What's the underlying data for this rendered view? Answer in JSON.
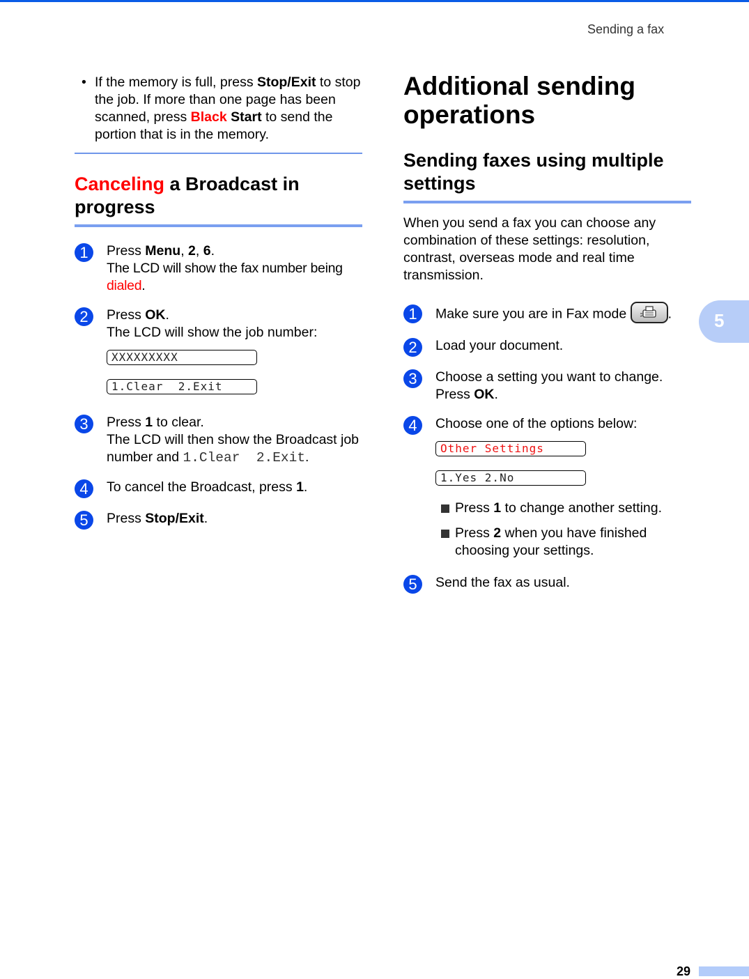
{
  "header": {
    "running_title": "Sending a fax"
  },
  "left": {
    "bullet": {
      "glyph": "•",
      "t1": "If the memory is full, press ",
      "b1": "Stop/Exit",
      "t2": " to stop the job. If more than one page has been scanned, press ",
      "r1": "Black",
      "t3": " ",
      "b2": "Start",
      "t4": " to send the portion that is in the memory."
    },
    "section_title_red": "Canceling",
    "section_title_rest": " a Broadcast in progress",
    "steps": [
      {
        "num": "1",
        "t1": "Press ",
        "b1": "Menu",
        "t2": ", ",
        "b2": "2",
        "t3": ", ",
        "b3": "6",
        "t4": ".",
        "line2": "The LCD will show the fax number being ",
        "red": "dialed",
        "end": "."
      },
      {
        "num": "2",
        "t1": "Press ",
        "b1": "OK",
        "t2": ".",
        "line2": "The LCD will show the job number:",
        "lcd1": "XXXXXXXXX",
        "lcd2": "1.Clear  2.Exit"
      },
      {
        "num": "3",
        "t1": "Press ",
        "b1": "1",
        "t2": " to clear.",
        "line2": "The LCD will then show the Broadcast job number and ",
        "mono": "1.Clear  2.Exit",
        "end": "."
      },
      {
        "num": "4",
        "t1": "To cancel the Broadcast, press ",
        "b1": "1",
        "t2": "."
      },
      {
        "num": "5",
        "t1": "Press ",
        "b1": "Stop/Exit",
        "t2": "."
      }
    ]
  },
  "right": {
    "h1": "Additional sending operations",
    "h2": "Sending faxes using multiple settings",
    "intro": "When you send a fax you can choose any combination of these settings: resolution, contrast, overseas mode and real time transmission.",
    "steps": [
      {
        "num": "1",
        "t1": "Make sure you are in Fax mode ",
        "icon": "fax-mode-button-icon",
        "t2": "."
      },
      {
        "num": "2",
        "t1": "Load your document."
      },
      {
        "num": "3",
        "t1": "Choose a setting you want to change.",
        "line2a": "Press ",
        "b1": "OK",
        "line2b": "."
      },
      {
        "num": "4",
        "t1": "Choose one of the options below:",
        "lcd1": "Other Settings",
        "lcd2": "1.Yes 2.No",
        "options": [
          {
            "t1": "Press ",
            "b1": "1",
            "t2": " to change another setting."
          },
          {
            "t1": "Press ",
            "b1": "2",
            "t2": " when you have finished choosing your settings."
          }
        ]
      },
      {
        "num": "5",
        "t1": "Send the fax as usual."
      }
    ]
  },
  "chapter_tab": {
    "label": "5"
  },
  "footer": {
    "page_number": "29"
  },
  "colors": {
    "accent_blue": "#0a47e8",
    "rule_blue": "#7a9ff0",
    "tab_blue": "#b7cdf8",
    "highlight_red": "#ff0000"
  }
}
